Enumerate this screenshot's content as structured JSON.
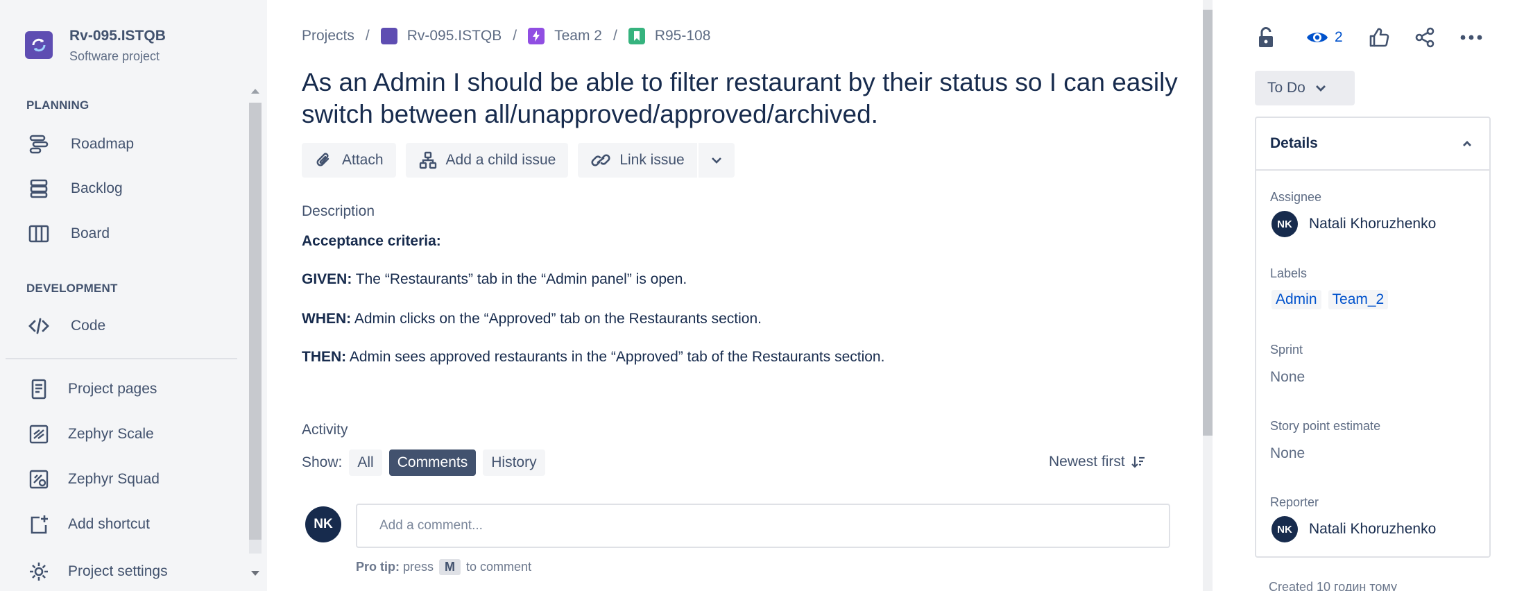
{
  "project": {
    "name": "Rv-095.ISTQB",
    "type": "Software project"
  },
  "sidebar": {
    "sections": [
      {
        "title": "PLANNING"
      },
      {
        "title": "DEVELOPMENT"
      }
    ],
    "items": [
      {
        "label": "Roadmap",
        "icon": "roadmap-icon"
      },
      {
        "label": "Backlog",
        "icon": "backlog-icon"
      },
      {
        "label": "Board",
        "icon": "board-icon"
      },
      {
        "label": "Code",
        "icon": "code-icon"
      },
      {
        "label": "Project pages",
        "icon": "pages-icon"
      },
      {
        "label": "Zephyr Scale",
        "icon": "zephyr-scale-icon"
      },
      {
        "label": "Zephyr Squad",
        "icon": "zephyr-squad-icon"
      },
      {
        "label": "Add shortcut",
        "icon": "add-shortcut-icon"
      },
      {
        "label": "Project settings",
        "icon": "settings-icon"
      }
    ]
  },
  "breadcrumb": {
    "items": [
      "Projects",
      "Rv-095.ISTQB",
      "Team 2",
      "R95-108"
    ],
    "separator": "/"
  },
  "issue": {
    "title": "As an Admin I should be able to filter restaurant by their status so I can easily switch between all/unapproved/approved/archived."
  },
  "toolbar": {
    "attach": "Attach",
    "add_child": "Add a child issue",
    "link_issue": "Link issue"
  },
  "description": {
    "label": "Description",
    "heading": "Acceptance criteria:",
    "given_key": "GIVEN:",
    "given_text": " The “Restaurants” tab in the “Admin panel” is open.",
    "when_key": "WHEN:",
    "when_text": " Admin clicks on the “Approved” tab on the Restaurants section.",
    "then_key": "THEN:",
    "then_text": " Admin sees approved restaurants in the “Approved” tab of the Restaurants section."
  },
  "activity": {
    "label": "Activity",
    "show_label": "Show:",
    "filters": [
      "All",
      "Comments",
      "History"
    ],
    "active_filter": "Comments",
    "sort": "Newest first",
    "comment_placeholder": "Add a comment...",
    "tip_prefix": "Pro tip:",
    "tip_press": "press",
    "tip_key": "M",
    "tip_suffix": "to comment"
  },
  "user": {
    "initials": "NK"
  },
  "right_panel": {
    "watch_count": "2",
    "status": "To Do",
    "details_title": "Details",
    "assignee_label": "Assignee",
    "assignee": "Natali Khoruzhenko",
    "labels_label": "Labels",
    "labels": [
      "Admin",
      "Team_2"
    ],
    "sprint_label": "Sprint",
    "sprint": "None",
    "story_points_label": "Story point estimate",
    "story_points": "None",
    "reporter_label": "Reporter",
    "reporter": "Natali Khoruzhenko",
    "created": "Created 10 годин тому"
  },
  "colors": {
    "sidebar_bg": "#f4f5f7",
    "text_primary": "#172b4d",
    "text_secondary": "#42526e",
    "link_blue": "#0052cc",
    "project_logo": "#5e4db2",
    "epic_purple": "#904ee2",
    "story_green": "#36b37e"
  }
}
